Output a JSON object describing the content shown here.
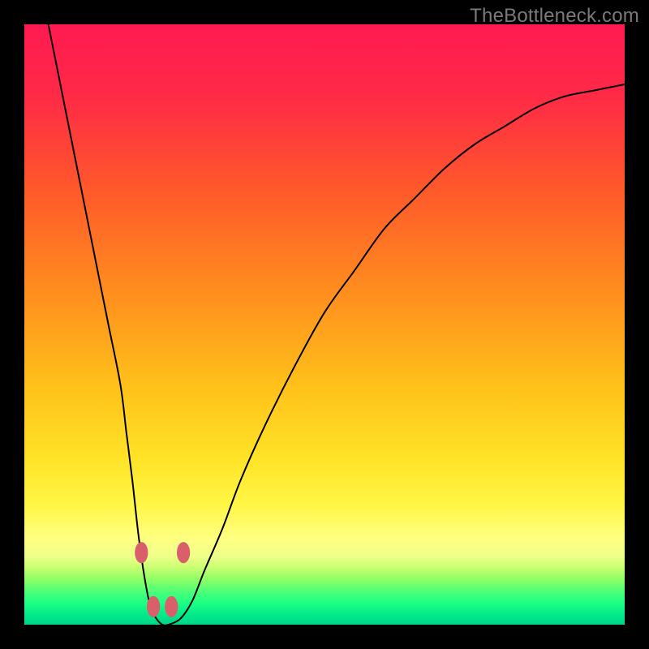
{
  "watermark": "TheBottleneck.com",
  "colors": {
    "frame": "#000000",
    "curve_stroke": "#000000",
    "marker_fill": "#d9606b",
    "gradient_stops": [
      {
        "offset": 0.0,
        "color": "#ff1a52"
      },
      {
        "offset": 0.12,
        "color": "#ff2a46"
      },
      {
        "offset": 0.28,
        "color": "#ff5a2a"
      },
      {
        "offset": 0.45,
        "color": "#ff8f1e"
      },
      {
        "offset": 0.6,
        "color": "#ffc01a"
      },
      {
        "offset": 0.72,
        "color": "#ffe226"
      },
      {
        "offset": 0.8,
        "color": "#fff645"
      },
      {
        "offset": 0.855,
        "color": "#ffff80"
      },
      {
        "offset": 0.885,
        "color": "#f0ff8a"
      },
      {
        "offset": 0.905,
        "color": "#c8ff70"
      },
      {
        "offset": 0.925,
        "color": "#8cff66"
      },
      {
        "offset": 0.945,
        "color": "#4dff78"
      },
      {
        "offset": 0.965,
        "color": "#1aff84"
      },
      {
        "offset": 0.985,
        "color": "#00e88a"
      },
      {
        "offset": 1.0,
        "color": "#00d686"
      }
    ]
  },
  "chart_data": {
    "type": "line",
    "title": "",
    "xlabel": "",
    "ylabel": "",
    "xlim": [
      0,
      100
    ],
    "ylim": [
      0,
      100
    ],
    "series": [
      {
        "name": "bottleneck-curve",
        "x": [
          4,
          6,
          8,
          10,
          12,
          14,
          16,
          17,
          18,
          19,
          20,
          21,
          22,
          23,
          24,
          26,
          28,
          30,
          33,
          36,
          40,
          45,
          50,
          55,
          60,
          65,
          70,
          75,
          80,
          85,
          90,
          95,
          100
        ],
        "values": [
          100,
          90,
          80,
          70,
          60,
          50,
          40,
          32,
          24,
          15,
          8,
          3,
          1,
          0,
          0,
          1,
          4,
          9,
          16,
          24,
          33,
          43,
          52,
          59,
          66,
          71,
          76,
          80,
          83,
          86,
          88,
          89,
          90
        ]
      }
    ],
    "markers": [
      {
        "name": "left-upper",
        "x": 19.5,
        "y": 12
      },
      {
        "name": "right-upper",
        "x": 26.5,
        "y": 12
      },
      {
        "name": "left-lower",
        "x": 21.5,
        "y": 3
      },
      {
        "name": "right-lower",
        "x": 24.5,
        "y": 3
      }
    ],
    "marker_radius_pct": 1.1
  }
}
